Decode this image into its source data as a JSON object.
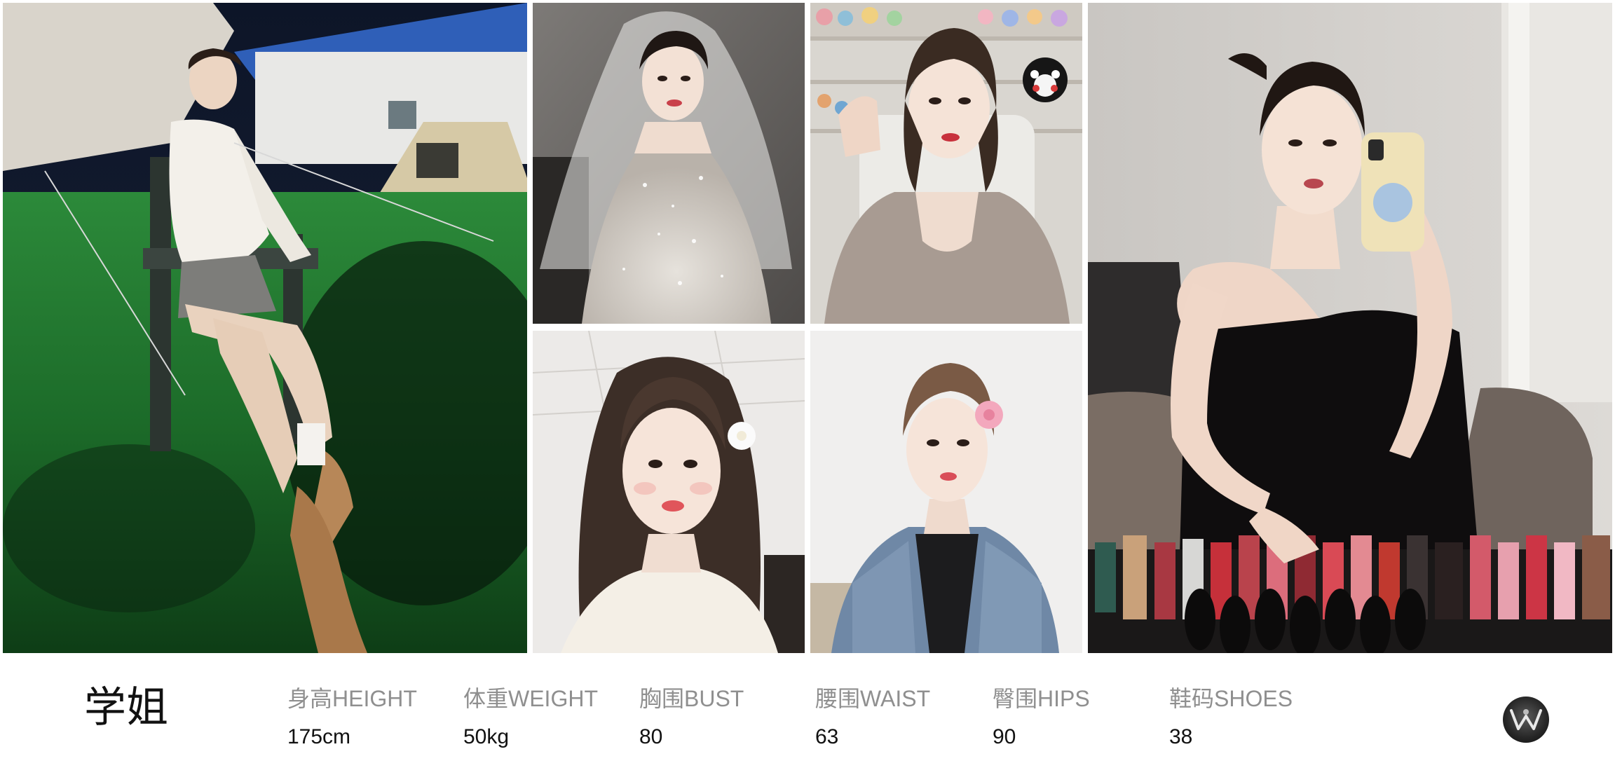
{
  "profile": {
    "name": "学姐"
  },
  "stats": [
    {
      "label": "身高HEIGHT",
      "value": "175cm"
    },
    {
      "label": "体重WEIGHT",
      "value": "50kg"
    },
    {
      "label": "胸围BUST",
      "value": "80"
    },
    {
      "label": "腰围WAIST",
      "value": "63"
    },
    {
      "label": "臀围HIPS",
      "value": "90"
    },
    {
      "label": "鞋码SHOES",
      "value": "38"
    }
  ],
  "gallery": [
    {
      "id": "photo-outdoor-chair",
      "scene": "night lawn, seated in camping chair, white blouse"
    },
    {
      "id": "photo-bridal-veil",
      "scene": "wedding veil and sequin gown"
    },
    {
      "id": "photo-selfie-figurines",
      "scene": "selfie, grey top, figurine shelf behind"
    },
    {
      "id": "photo-selfie-white-flower",
      "scene": "selfie, white flower in hair"
    },
    {
      "id": "photo-denim-jacket",
      "scene": "denim jacket, pink flower in hair"
    },
    {
      "id": "photo-mirror-selfie",
      "scene": "mirror selfie, black velvet dress, lipsticks"
    }
  ],
  "colors": {
    "label_gray": "#8f8f8f",
    "value_black": "#111111",
    "background": "#ffffff"
  },
  "logo": {
    "icon": "brand-logo-icon"
  }
}
